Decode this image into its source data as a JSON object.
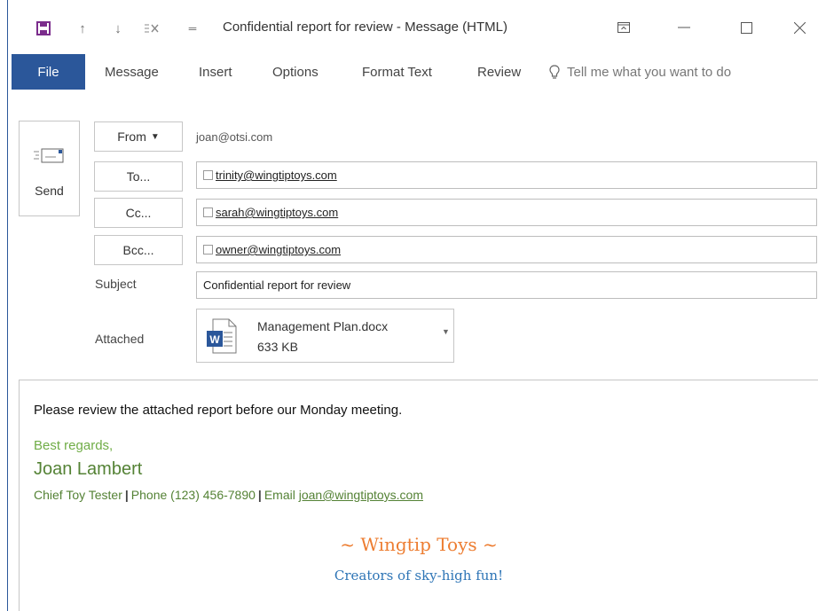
{
  "window": {
    "title": "Confidential report for review  -  Message (HTML)"
  },
  "ribbon": {
    "tabs": [
      {
        "label": "File"
      },
      {
        "label": "Message"
      },
      {
        "label": "Insert"
      },
      {
        "label": "Options"
      },
      {
        "label": "Format Text"
      },
      {
        "label": "Review"
      }
    ],
    "tell_me": "Tell me what you want to do"
  },
  "colors": {
    "accent": "#2b579a",
    "signature_green": "#70ad47",
    "signature_dark_green": "#548235",
    "brand_orange": "#ed7d31",
    "tagline_blue": "#2e75b6"
  },
  "header": {
    "send_label": "Send",
    "from_label": "From",
    "from_value": "joan@otsi.com",
    "to_label": "To...",
    "to_value": "trinity@wingtiptoys.com",
    "cc_label": "Cc...",
    "cc_value": "sarah@wingtiptoys.com",
    "bcc_label": "Bcc...",
    "bcc_value": "owner@wingtiptoys.com",
    "subject_label": "Subject",
    "subject_value": "Confidential report for review",
    "attached_label": "Attached",
    "attachment": {
      "name": "Management Plan.docx",
      "size": "633 KB",
      "icon": "word-document-icon"
    }
  },
  "body": {
    "text": "Please review the attached report before our Monday meeting.",
    "signature": {
      "closing": "Best regards,",
      "name": "Joan Lambert",
      "title": "Chief Toy Tester",
      "phone": "Phone (123) 456-7890",
      "email_label": "Email",
      "email": "joan@wingtiptoys.com",
      "separator": "|"
    },
    "brand": "~ Wingtip Toys ~",
    "tagline": "Creators of sky-high fun!"
  }
}
